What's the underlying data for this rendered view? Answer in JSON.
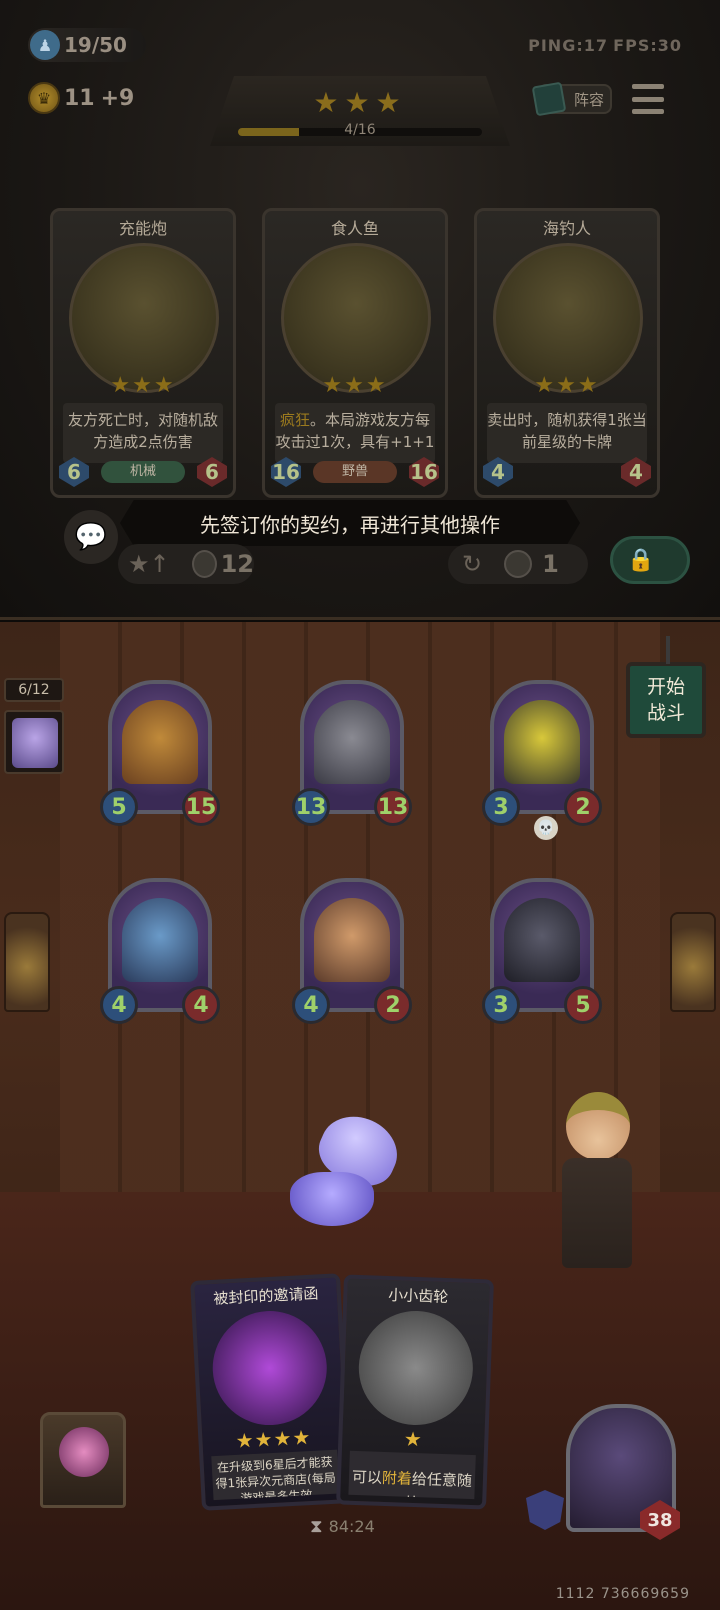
{
  "top_bar": {
    "population": "19/50",
    "ping": "PING:17",
    "fps": "FPS:30",
    "gold": "11",
    "gold_income": "+9",
    "tavern_stars": "★★★",
    "level_progress": "4/16",
    "level_progress_fraction": 0.25,
    "lineup_label": "阵容"
  },
  "shop_cards": [
    {
      "name": "充能炮",
      "stars": "★★★",
      "desc_pre": "友方死亡时，对随机敌方造成2点伤害",
      "keyword": "",
      "desc_post": "",
      "tribe": "机械",
      "attack": "6",
      "health": "6"
    },
    {
      "name": "食人鱼",
      "stars": "★★★",
      "desc_pre": "",
      "keyword": "疯狂",
      "desc_post": "。本局游戏友方每攻击过1次，具有+1+1",
      "tribe": "野兽",
      "attack": "16",
      "health": "16"
    },
    {
      "name": "海钓人",
      "stars": "★★★",
      "desc_pre": "卖出时，随机获得1张当前星级的卡牌",
      "keyword": "",
      "desc_post": "",
      "tribe": "",
      "attack": "4",
      "health": "4"
    }
  ],
  "hint": "先签订你的契约，再进行其他操作",
  "shop_actions": {
    "upgrade_cost": "12",
    "refresh_cost": "1"
  },
  "board": {
    "wave": "6/12",
    "start_battle": [
      "开始",
      "战斗"
    ],
    "minions": [
      {
        "attack": "5",
        "health": "15"
      },
      {
        "attack": "13",
        "health": "13"
      },
      {
        "attack": "3",
        "health": "2",
        "badge": "💀"
      },
      {
        "attack": "4",
        "health": "4"
      },
      {
        "attack": "4",
        "health": "2"
      },
      {
        "attack": "3",
        "health": "5"
      }
    ]
  },
  "hand_cards": [
    {
      "name": "被封印的邀请函",
      "stars": "★★★★",
      "desc": "在升级到6星后才能获得1张异次元商店(每局游戏最多生效"
    },
    {
      "name": "小小齿轮",
      "stars": "★",
      "desc_pre": "可以",
      "keyword": "附着",
      "desc_post": "给任意随从"
    }
  ],
  "bottom": {
    "timer": "84:24",
    "player_health": "38",
    "uid": "1112 736669659"
  },
  "colors": {
    "star_gold": "#e2b43a",
    "attack_blue": "#2d4f7a",
    "health_red": "#7a2b2b",
    "stat_green": "#9fd06a",
    "start_button": "#1f4a3a"
  }
}
